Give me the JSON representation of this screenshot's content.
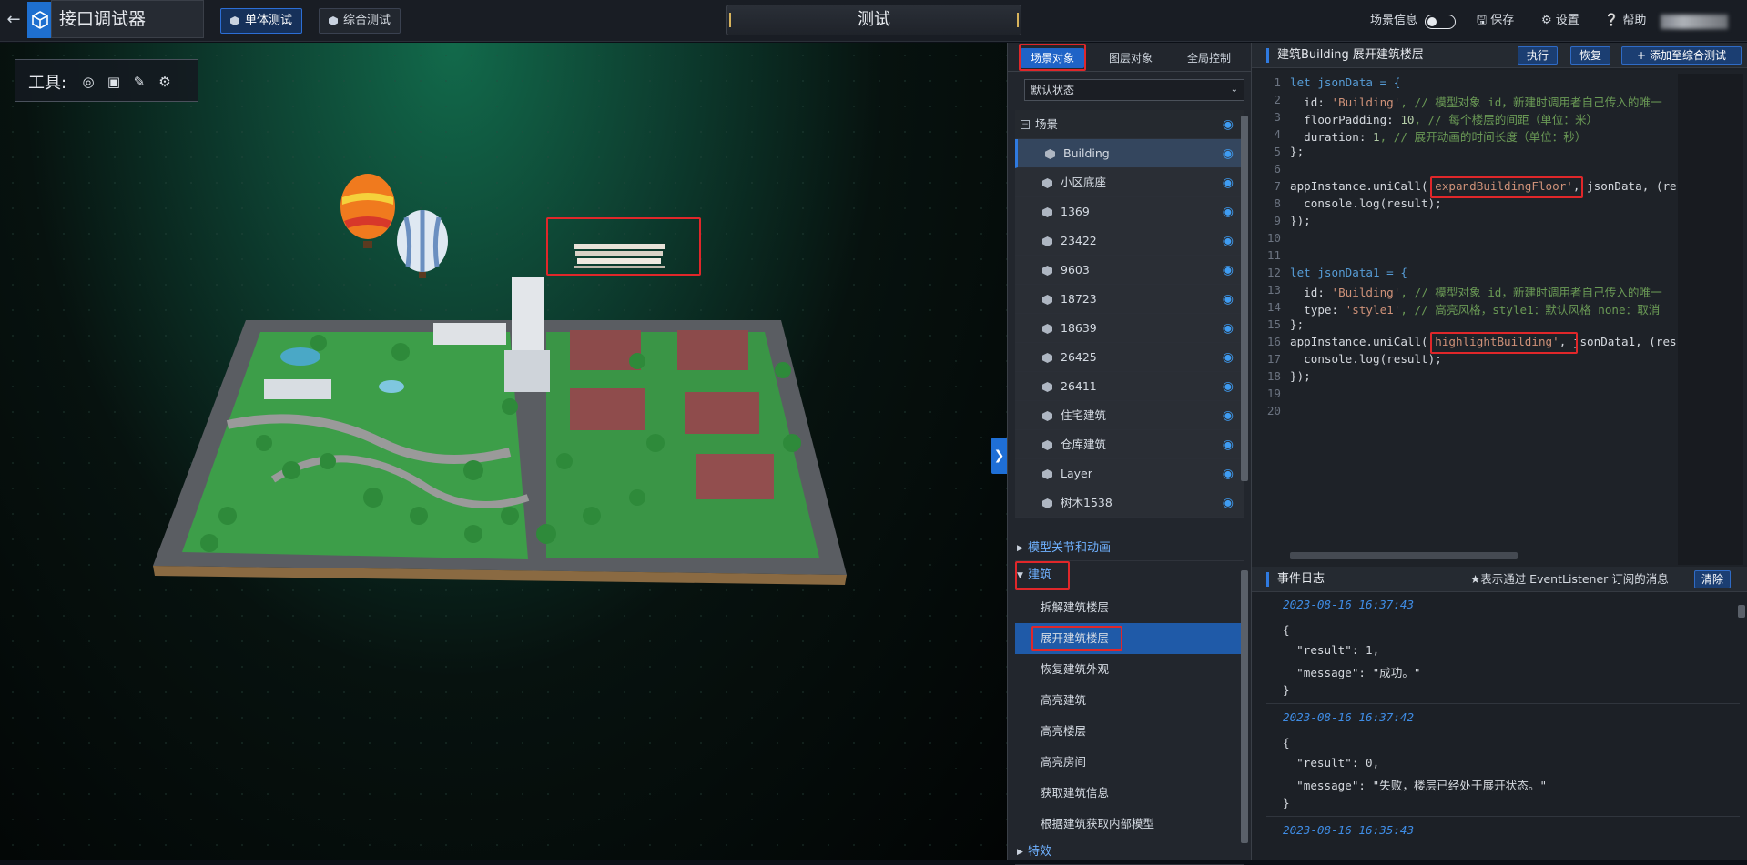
{
  "app": {
    "title": "接口调试器",
    "back_icon": "arrow-left-icon",
    "logo_icon": "cube-logo-icon"
  },
  "header": {
    "modes": [
      {
        "label": "单体测试",
        "active": true
      },
      {
        "label": "综合测试",
        "active": false
      }
    ],
    "center_title": "测试",
    "scene_info_label": "场景信息",
    "save_label": "保存",
    "settings_label": "设置",
    "help_label": "帮助"
  },
  "viewport": {
    "tools_label": "工具:"
  },
  "scene_panel": {
    "tabs": [
      {
        "label": "场景对象",
        "active": true
      },
      {
        "label": "图层对象",
        "active": false
      },
      {
        "label": "全局控制",
        "active": false
      }
    ],
    "state_select": "默认状态",
    "tree": [
      {
        "label": "场景",
        "type": "root"
      },
      {
        "label": "Building",
        "selected": true
      },
      {
        "label": "小区底座"
      },
      {
        "label": "1369"
      },
      {
        "label": "23422"
      },
      {
        "label": "9603"
      },
      {
        "label": "18723"
      },
      {
        "label": "18639"
      },
      {
        "label": "26425"
      },
      {
        "label": "26411"
      },
      {
        "label": "住宅建筑"
      },
      {
        "label": "仓库建筑"
      },
      {
        "label": "Layer"
      },
      {
        "label": "树木1538"
      }
    ],
    "sections": [
      {
        "label": "模型关节和动画",
        "open": false
      },
      {
        "label": "建筑",
        "open": true
      },
      {
        "label": "特效",
        "open": false
      }
    ],
    "building_apis": [
      {
        "label": "拆解建筑楼层",
        "active": false
      },
      {
        "label": "展开建筑楼层",
        "active": true
      },
      {
        "label": "恢复建筑外观",
        "active": false
      },
      {
        "label": "高亮建筑",
        "active": false
      },
      {
        "label": "高亮楼层",
        "active": false
      },
      {
        "label": "高亮房间",
        "active": false
      },
      {
        "label": "获取建筑信息",
        "active": false
      },
      {
        "label": "根据建筑获取内部模型",
        "active": false
      }
    ]
  },
  "editor": {
    "title": "建筑Building 展开建筑楼层",
    "run_label": "执行",
    "reset_label": "恢复",
    "add_label": "添加至综合测试",
    "lines": [
      "1",
      "2",
      "3",
      "4",
      "5",
      "6",
      "7",
      "8",
      "9",
      "10",
      "11",
      "12",
      "13",
      "14",
      "15",
      "16",
      "17",
      "18",
      "19",
      "20"
    ],
    "code": {
      "l1": "let jsonData = {",
      "l2a": "  id: ",
      "l2b": "'Building'",
      "l2c": ", // 模型对象 id，新建时调用者自己传入的唯一",
      "l3a": "  floorPadding: ",
      "l3b": "10",
      "l3c": ", // 每个楼层的间距（单位：米）",
      "l4a": "  duration: ",
      "l4b": "1",
      "l4c": ", // 展开动画的时间长度（单位：秒）",
      "l5": "};",
      "l7a": "appInstance.uniCall(",
      "l7b": "'expandBuildingFloor'",
      "l7c": ", jsonData, (re",
      "l8": "  console.log(result);",
      "l9": "});",
      "l12": "let jsonData1 = {",
      "l13a": "  id: ",
      "l13b": "'Building'",
      "l13c": ", // 模型对象 id，新建时调用者自己传入的唯一",
      "l14a": "  type: ",
      "l14b": "'style1'",
      "l14c": ", // 高亮风格，style1：默认风格 none：取消",
      "l15": "};",
      "l16a": "appInstance.uniCall(",
      "l16b": "'highlightBuilding'",
      "l16c": ", jsonData1, (res",
      "l17": "  console.log(result);",
      "l18": "});"
    }
  },
  "event_log": {
    "title": "事件日志",
    "hint": "★表示通过 EventListener 订阅的消息",
    "clear_label": "清除",
    "entries": [
      {
        "time": "2023-08-16 16:37:43",
        "l1": "{",
        "l2": "  \"result\": 1,",
        "l3": "  \"message\": \"成功。\"",
        "l4": "}"
      },
      {
        "time": "2023-08-16 16:37:42",
        "l1": "{",
        "l2": "  \"result\": 0,",
        "l3": "  \"message\": \"失败，楼层已经处于展开状态。\"",
        "l4": "}"
      },
      {
        "time": "2023-08-16 16:35:43"
      }
    ]
  },
  "colors": {
    "accent": "#1f63c7",
    "highlight_red": "#e0272a",
    "link_blue": "#6fb1ff"
  }
}
